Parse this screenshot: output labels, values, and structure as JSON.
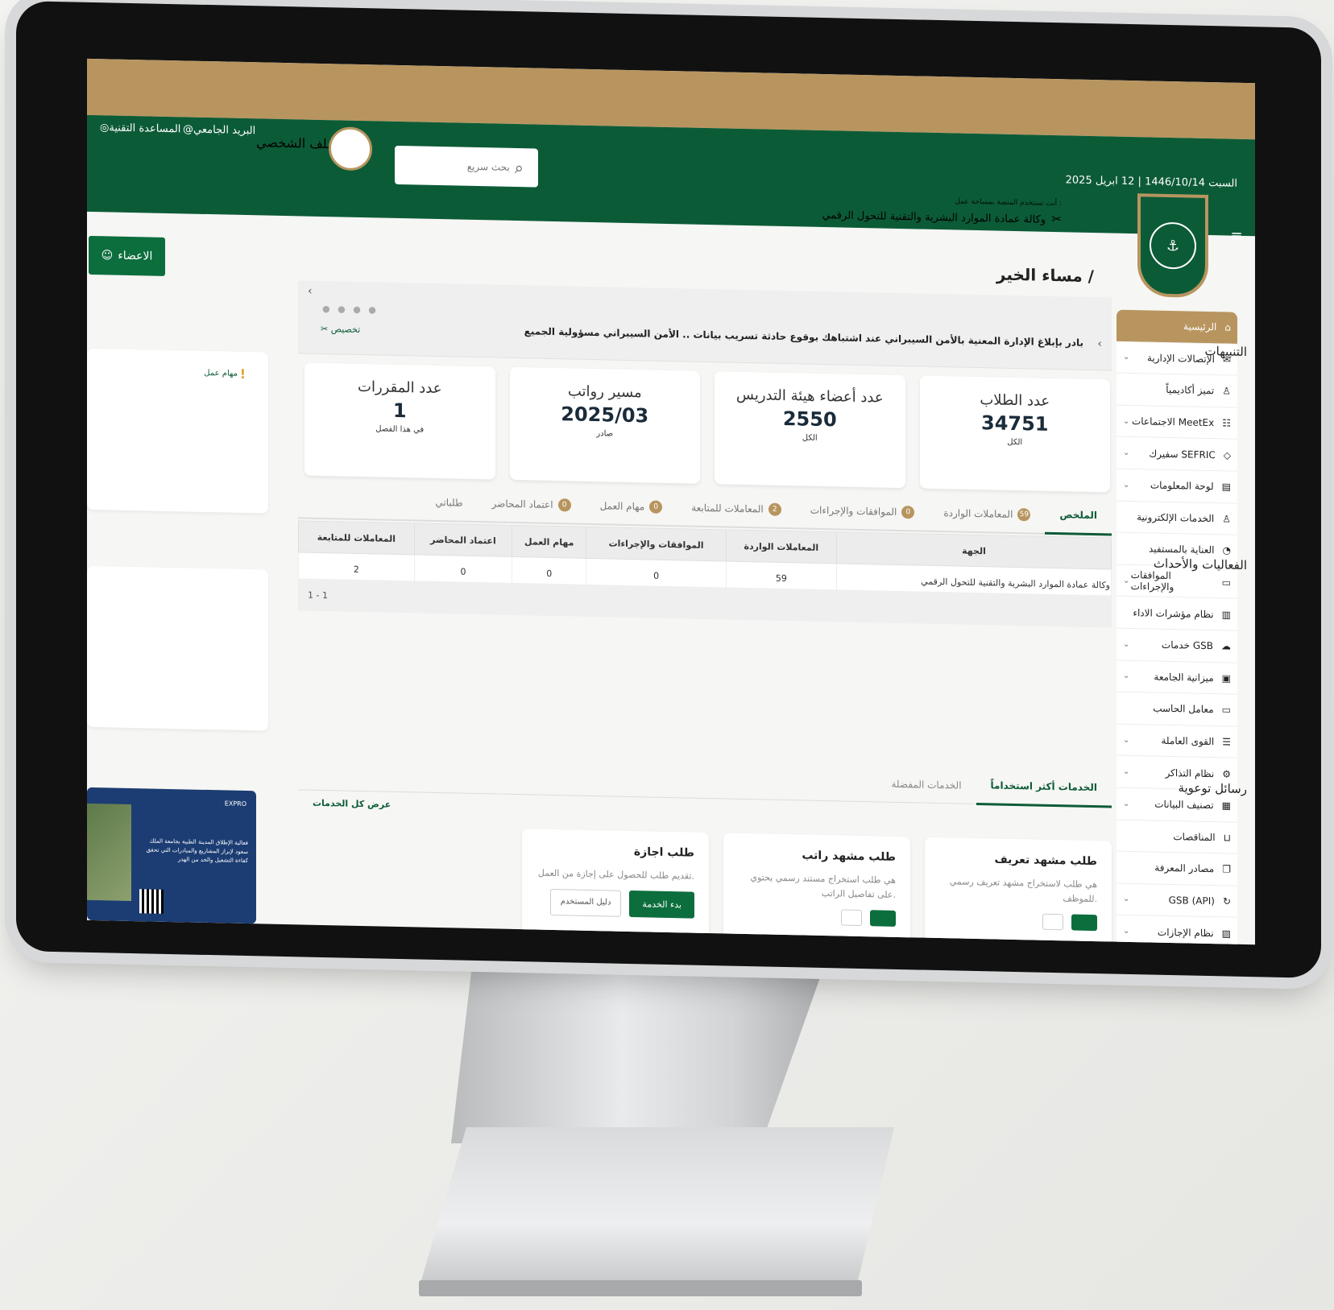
{
  "header": {
    "tech_support": "المساعدة التقنية",
    "university_mail": "البريد الجامعي",
    "profile": "الملف الشخصي",
    "search_placeholder": "بحث سريع",
    "date": "السبت 1446/10/14 | 12 ابريل 2025",
    "workspace_note": "أنت تستخدم المنصة بمساحة عمل :",
    "workspace_name": "وكالة عمادة الموارد البشرية والتقنية للتحول الرقمي"
  },
  "members_button": "الاعضاء",
  "greeting": "مساء الخير /",
  "banner": {
    "text": "بادر بإبلاغ الإدارة المعنية بالأمن السيبراني عند اشتباهك بوقوع حادثة تسريب بيانات .. الأمن السيبراني مسؤولية الجميع",
    "customize": "تخصيص"
  },
  "sidebar": {
    "items": [
      {
        "label": "الرئيسية",
        "icon": "home-icon"
      },
      {
        "label": "الإتصالات الإدارية",
        "icon": "mail-icon"
      },
      {
        "label": "تميز أكاديمياً",
        "icon": "award-icon"
      },
      {
        "label": "الاجتماعات MeetEx",
        "icon": "meeting-icon"
      },
      {
        "label": "سفيرك SEFRIC",
        "icon": "ambassador-icon"
      },
      {
        "label": "لوحة المعلومات",
        "icon": "dashboard-icon"
      },
      {
        "label": "الخدمات الإلكترونية",
        "icon": "user-service-icon"
      },
      {
        "label": "العناية بالمستفيد",
        "icon": "care-icon"
      },
      {
        "label": "الموافقات والإجراءات",
        "icon": "folder-icon"
      },
      {
        "label": "نظام مؤشرات الاداء",
        "icon": "chart-icon"
      },
      {
        "label": "خدمات GSB",
        "icon": "cloud-icon"
      },
      {
        "label": "ميزانية الجامعة",
        "icon": "budget-icon"
      },
      {
        "label": "معامل الحاسب",
        "icon": "computer-icon"
      },
      {
        "label": "القوى العاملة",
        "icon": "workforce-icon"
      },
      {
        "label": "نظام التذاكر",
        "icon": "ticket-icon"
      },
      {
        "label": "تصنيف البيانات",
        "icon": "data-icon"
      },
      {
        "label": "المناقصات",
        "icon": "cart-icon"
      },
      {
        "label": "مصادر المعرفة",
        "icon": "book-icon"
      },
      {
        "label": "GSB (API)",
        "icon": "api-icon"
      },
      {
        "label": "نظام الإجازات",
        "icon": "leave-icon"
      }
    ]
  },
  "stats": [
    {
      "title": "عدد الطلاب",
      "value": "34751",
      "sub": "الكل"
    },
    {
      "title": "عدد أعضاء هيئة التدريس",
      "value": "2550",
      "sub": "الكل"
    },
    {
      "title": "مسير رواتب",
      "value": "2025/03",
      "sub": "صادر"
    },
    {
      "title": "عدد المقررات",
      "value": "1",
      "sub": "في هذا الفصل"
    }
  ],
  "tabs": [
    {
      "label": "الملخص",
      "count": ""
    },
    {
      "label": "المعاملات الواردة",
      "count": "59"
    },
    {
      "label": "الموافقات والإجراءات",
      "count": "0"
    },
    {
      "label": "المعاملات للمتابعة",
      "count": "2"
    },
    {
      "label": "مهام العمل",
      "count": "0"
    },
    {
      "label": "اعتماد المحاضر",
      "count": "0"
    },
    {
      "label": "طلباتي",
      "count": ""
    }
  ],
  "table": {
    "headers": [
      "الجهة",
      "المعاملات الواردة",
      "الموافقات والإجراءات",
      "مهام العمل",
      "اعتماد المحاضر",
      "المعاملات للمتابعة"
    ],
    "rows": [
      [
        "وكالة عمادة الموارد البشرية والتقنية للتحول الرقمي",
        "59",
        "0",
        "0",
        "0",
        "2"
      ]
    ],
    "pager": "1 - 1"
  },
  "services": {
    "tabs": [
      "الخدمات أكثر استخداماً",
      "الخدمات المفضلة"
    ],
    "view_all": "عرض كل الخدمات",
    "cards": [
      {
        "title": "طلب مشهد تعريف",
        "desc": "هي طلب لاستخراج مشهد تعريف رسمي للموظف.",
        "primary": "",
        "secondary": ""
      },
      {
        "title": "طلب مشهد راتب",
        "desc": "هي طلب استخراج مستند رسمي يحتوي على تفاصيل الراتب.",
        "primary": "",
        "secondary": ""
      },
      {
        "title": "طلب اجازة",
        "desc": "تقديم طلب للحصول على إجازة من العمل.",
        "primary": "بدء الخدمة",
        "secondary": "دليل المستخدم"
      }
    ]
  },
  "left": {
    "alerts_title": "التنبيهات",
    "alert_item": "مهام عمل",
    "events_title": "الفعاليات والأحداث",
    "awareness_title": "رسائل توعوية",
    "poster_text": "فعالية الإطلاق المدينة الطبية بجامعة الملك سعود لإبراز المشاريع والمبادرات التي تحقق كفاءة التشغيل والحد من الهدر",
    "poster_logo": "EXPRO"
  },
  "colors": {
    "primary": "#0c5b37",
    "gold": "#b8955f"
  }
}
